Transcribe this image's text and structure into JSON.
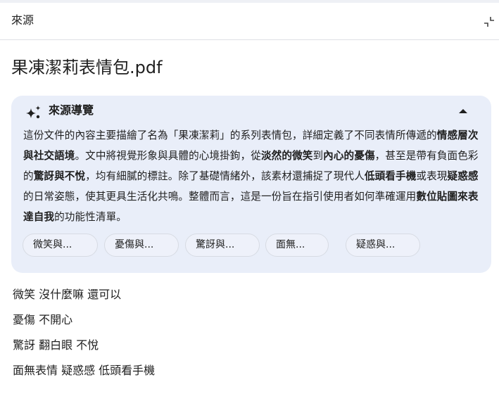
{
  "header": {
    "title": "來源"
  },
  "document": {
    "title": "果凍潔莉表情包.pdf"
  },
  "guide": {
    "title": "來源導覽",
    "summary_segments": [
      {
        "text": "這份文件的內容主要描繪了名為「果凍潔莉」的系列表情包，詳細定義了不同表情所傳遞的",
        "bold": false
      },
      {
        "text": "情感層次與社交語境",
        "bold": true
      },
      {
        "text": "。文中將視覺形象與具體的心境掛鉤，從",
        "bold": false
      },
      {
        "text": "淡然的微笑",
        "bold": true
      },
      {
        "text": "到",
        "bold": false
      },
      {
        "text": "內心的憂傷",
        "bold": true
      },
      {
        "text": "，甚至是帶有負面色彩的",
        "bold": false
      },
      {
        "text": "驚訝與不悅",
        "bold": true
      },
      {
        "text": "，均有細膩的標註。除了基礎情緒外，該素材還捕捉了現代人",
        "bold": false
      },
      {
        "text": "低頭看手機",
        "bold": true
      },
      {
        "text": "或表現",
        "bold": false
      },
      {
        "text": "疑惑感",
        "bold": true
      },
      {
        "text": "的日常姿態，使其更具生活化共鳴。整體而言，這是一份旨在指引使用者如何準確運用",
        "bold": false
      },
      {
        "text": "數位貼圖來表達自我",
        "bold": true
      },
      {
        "text": "的功能性清單。",
        "bold": false
      }
    ],
    "chips": [
      "微笑與...",
      "憂傷與...",
      "驚訝與...",
      "面無...",
      "疑惑與..."
    ]
  },
  "tags": [
    "微笑 沒什麼嘛 還可以",
    "憂傷 不開心",
    "驚訝 翻白眼 不悅",
    "面無表情 疑惑感 低頭看手機"
  ],
  "icons": {
    "collapse": "collapse-arrows-icon",
    "guide": "sparkle-icon",
    "toggle": "caret-up-icon"
  }
}
